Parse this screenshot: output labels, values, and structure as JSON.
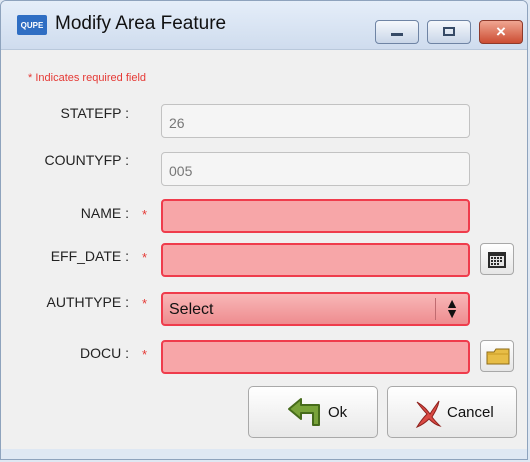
{
  "window": {
    "title": "Modify Area Feature",
    "app_icon_text": "QUPE"
  },
  "form": {
    "required_note": "* Indicates required field",
    "required_marker": "*",
    "fields": {
      "statefp": {
        "label": "STATEFP :",
        "value": "26"
      },
      "countyfp": {
        "label": "COUNTYFP :",
        "value": "005"
      },
      "name": {
        "label": "NAME :",
        "value": ""
      },
      "eff_date": {
        "label": "EFF_DATE :",
        "value": ""
      },
      "authtype": {
        "label": "AUTHTYPE :",
        "value": "Select"
      },
      "docu": {
        "label": "DOCU :",
        "value": ""
      }
    }
  },
  "buttons": {
    "ok": "Ok",
    "cancel": "Cancel"
  },
  "icons": {
    "calendar": "calendar-icon",
    "folder": "folder-icon",
    "ok": "green-arrow-icon",
    "cancel": "red-x-icon"
  },
  "colors": {
    "required": "#e53935",
    "invalid_fill": "#f7a6a8",
    "invalid_border": "#ef3c4c"
  }
}
